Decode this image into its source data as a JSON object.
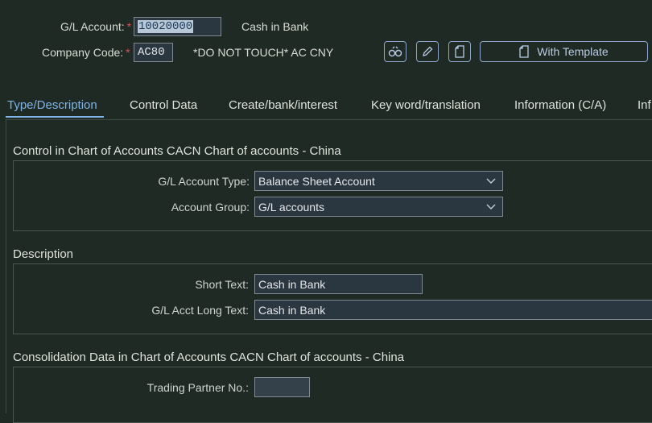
{
  "header": {
    "gl_account_label": "G/L Account:",
    "gl_account_value": "10020000",
    "gl_account_desc": "Cash in Bank",
    "company_code_label": "Company Code:",
    "company_code_value": "AC80",
    "company_code_desc": "*DO NOT TOUCH* AC CNY",
    "required_marker": "*",
    "with_template_label": "With Template",
    "icons": [
      "display-icon",
      "edit-pencil-icon",
      "copy-document-icon",
      "template-document-icon"
    ]
  },
  "tabs": [
    {
      "label": "Type/Description",
      "active": true
    },
    {
      "label": "Control Data"
    },
    {
      "label": "Create/bank/interest"
    },
    {
      "label": "Key word/translation"
    },
    {
      "label": "Information (C/A)"
    },
    {
      "label": "Inf"
    }
  ],
  "control_section": {
    "title": "Control in Chart of Accounts CACN Chart of accounts - China",
    "account_type_label": "G/L Account Type:",
    "account_type_value": "Balance Sheet Account",
    "account_group_label": "Account Group:",
    "account_group_value": "G/L accounts"
  },
  "description_section": {
    "title": "Description",
    "short_text_label": "Short Text:",
    "short_text_value": "Cash in Bank",
    "long_text_label": "G/L Acct Long Text:",
    "long_text_value": "Cash in Bank"
  },
  "consolidation_section": {
    "title": "Consolidation Data in Chart of Accounts CACN Chart of accounts - China",
    "trading_partner_label": "Trading Partner No.:",
    "trading_partner_value": ""
  },
  "colors": {
    "background": "#1f2a24",
    "accent": "#7fb4e6",
    "required": "#e05050"
  }
}
